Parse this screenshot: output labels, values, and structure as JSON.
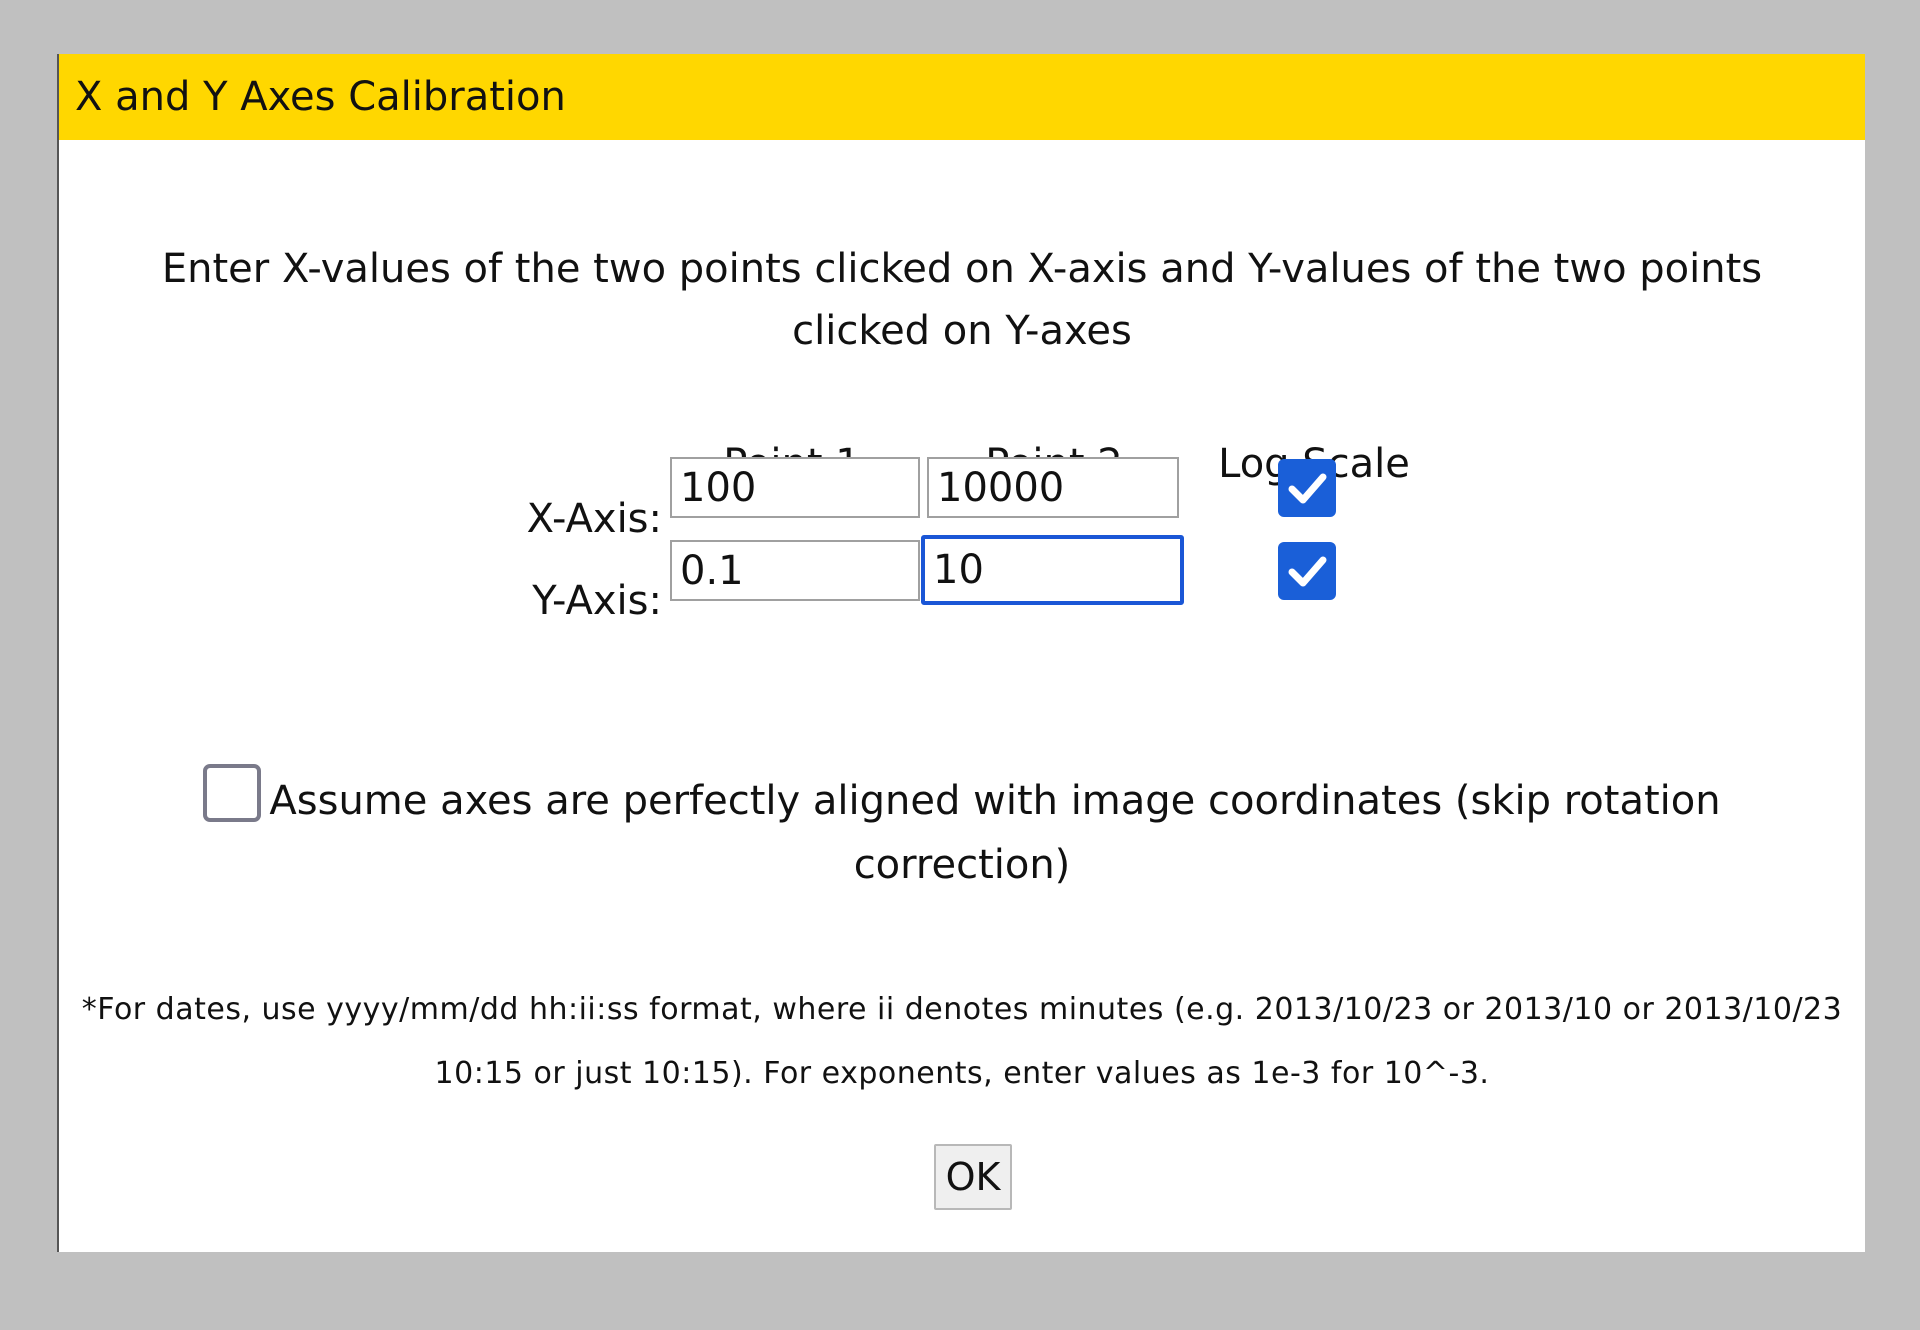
{
  "dialog": {
    "title": "X and Y Axes Calibration",
    "instructions": "Enter X-values of the two points clicked on X-axis and Y-values of the two points clicked on Y-axes",
    "columns": {
      "point1": "Point 1",
      "point2": "Point 2",
      "log_scale": "Log Scale"
    },
    "x_axis": {
      "label": "X-Axis:",
      "point1": "100",
      "point2": "10000",
      "log_scale": true
    },
    "y_axis": {
      "label": "Y-Axis:",
      "point1": "0.1",
      "point2": "10",
      "log_scale": true
    },
    "assume_aligned": {
      "label": "Assume axes are perfectly aligned with image coordinates (skip rotation correction)",
      "checked": false
    },
    "note": "*For dates, use yyyy/mm/dd hh:ii:ss format, where ii denotes minutes (e.g. 2013/10/23 or 2013/10 or 2013/10/23 10:15 or just 10:15). For exponents, enter values as 1e-3 for 10^-3.",
    "ok_label": "OK"
  },
  "colors": {
    "titlebar": "#ffd700",
    "checkbox_checked": "#1a5fd8",
    "focus_ring": "#1a56d6",
    "backdrop": "#c0c0c0"
  },
  "icons": {
    "checked": "checkmark-icon"
  }
}
